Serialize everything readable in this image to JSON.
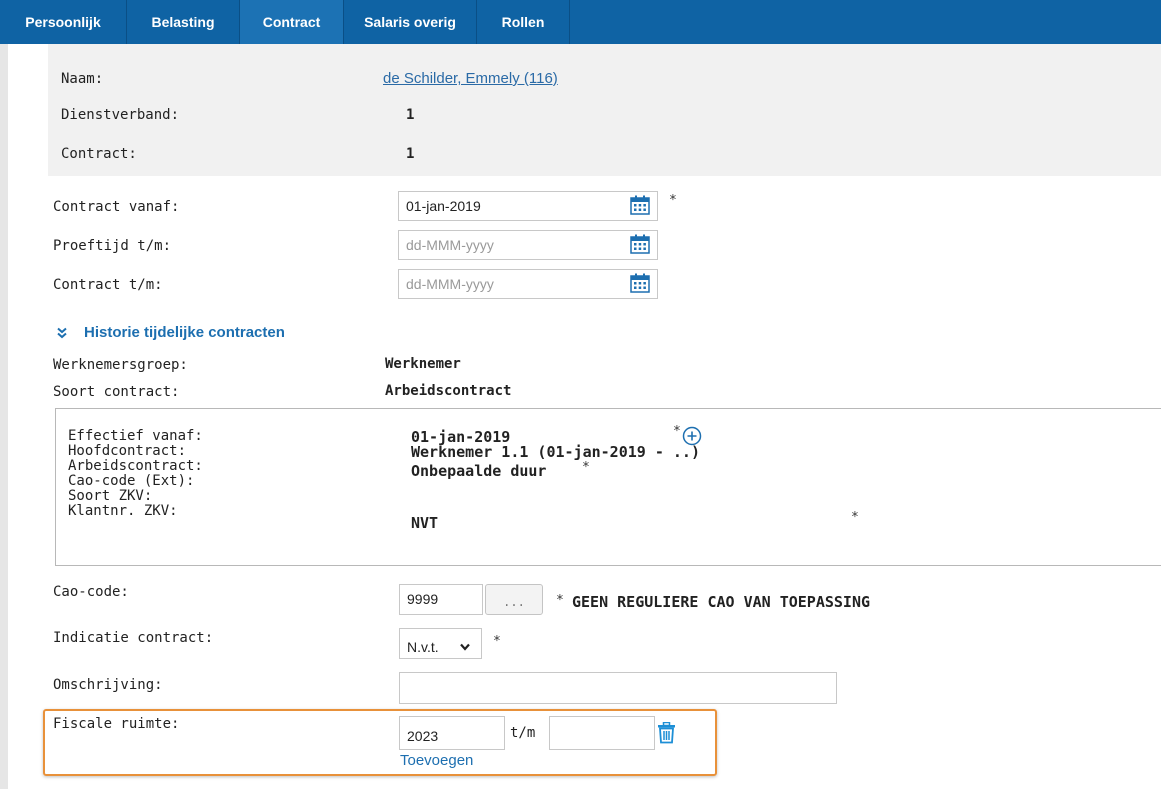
{
  "tabs": [
    {
      "label": "Persoonlijk"
    },
    {
      "label": "Belasting"
    },
    {
      "label": "Contract"
    },
    {
      "label": "Salaris overig"
    },
    {
      "label": "Rollen"
    }
  ],
  "header": {
    "naam_label": "Naam:",
    "naam_value": "de Schilder, Emmely (116)",
    "dienstverband_label": "Dienstverband:",
    "dienstverband_value": "1",
    "contract_label": "Contract:",
    "contract_value": "1"
  },
  "dates": {
    "contract_vanaf_label": "Contract vanaf:",
    "contract_vanaf_value": "01-jan-2019",
    "proeftijd_label": "Proeftijd t/m:",
    "proeftijd_placeholder": "dd-MMM-yyyy",
    "contract_tm_label": "Contract t/m:",
    "contract_tm_placeholder": "dd-MMM-yyyy",
    "required_mark": "*"
  },
  "historie": {
    "toggle_icon": "double-chevron-down",
    "label": "Historie tijdelijke contracten"
  },
  "groep": {
    "werknemersgroep_label": "Werknemersgroep:",
    "werknemersgroep_value": "Werknemer",
    "soort_contract_label": "Soort contract:",
    "soort_contract_value": "Arbeidscontract"
  },
  "detail_box": {
    "effectief_label": "Effectief vanaf:",
    "effectief_value": "01-jan-2019",
    "hoofdcontract_label": "Hoofdcontract:",
    "hoofdcontract_value": "Werknemer 1.1 (01-jan-2019 - ..)",
    "arbeidscontract_label": "Arbeidscontract:",
    "arbeidscontract_value": "Onbepaalde duur",
    "cao_ext_label": "Cao-code (Ext):",
    "soort_zkv_label": "Soort ZKV:",
    "soort_zkv_value": "NVT",
    "klantnr_label": "Klantnr. ZKV:",
    "required_mark": "*"
  },
  "cao": {
    "label": "Cao-code:",
    "value": "9999",
    "lookup_label": "...",
    "required_mark": "*",
    "description": "GEEN REGULIERE CAO VAN TOEPASSING"
  },
  "indicatie": {
    "label": "Indicatie contract:",
    "selected": "N.v.t.",
    "required_mark": "*"
  },
  "omschrijving": {
    "label": "Omschrijving:",
    "value": ""
  },
  "fiscale": {
    "label": "Fiscale ruimte:",
    "from_value": "2023",
    "tm_label": "t/m",
    "to_value": "",
    "add_label": "Toevoegen"
  },
  "colors": {
    "tab_bar": "#0f63a4",
    "link": "#1d6fb0",
    "highlight": "#e8913a"
  }
}
